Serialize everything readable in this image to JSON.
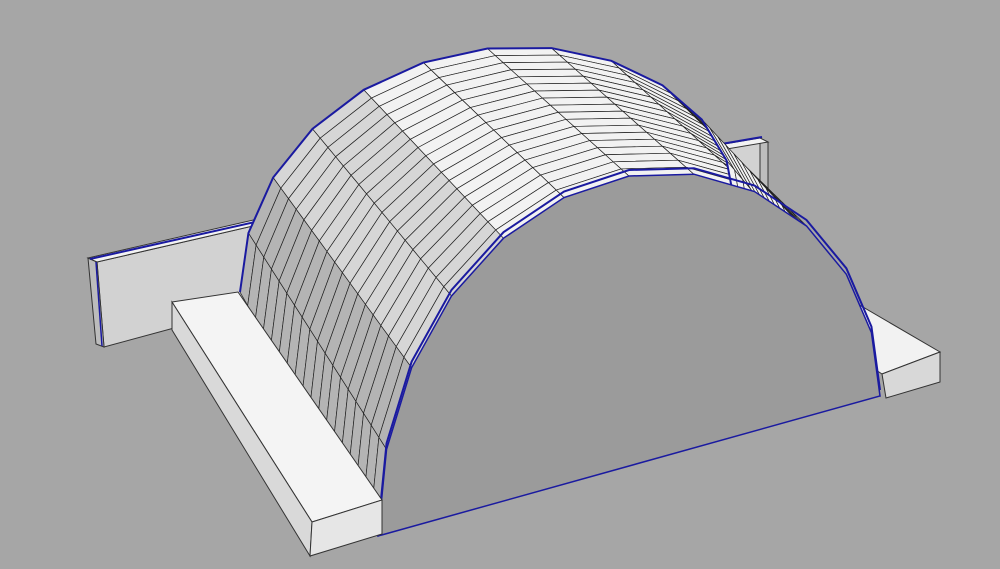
{
  "scene": {
    "kind": "3d-viewport",
    "objects": [
      {
        "name": "barrel-vault",
        "courses": 12,
        "ribs": 18
      },
      {
        "name": "back-wall"
      },
      {
        "name": "right-side-wall"
      },
      {
        "name": "left-side-wall"
      },
      {
        "name": "front-abutment"
      },
      {
        "name": "rear-abutment"
      }
    ]
  },
  "colors": {
    "background": "#a6a6a6",
    "face_light": "#f2f2f2",
    "face_mid": "#d6d6d6",
    "face_dark": "#b4b4b4",
    "face_shadow": "#9b9b9b",
    "edge": "#222222",
    "highlight": "#1a1aa0"
  }
}
